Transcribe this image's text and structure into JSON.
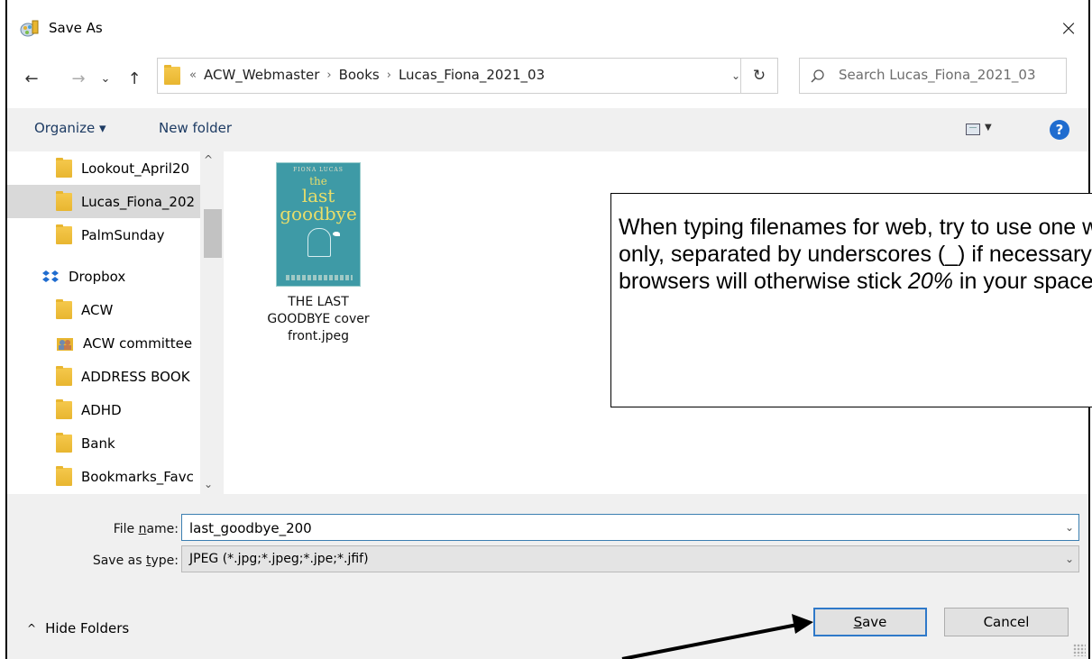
{
  "window": {
    "title": "Save As",
    "close_label": "×"
  },
  "nav": {
    "back": "←",
    "forward": "→",
    "recent": "⌄",
    "up": "↑"
  },
  "address": {
    "prefix": "«",
    "crumbs": [
      "ACW_Webmaster",
      "Books",
      "Lucas_Fiona_2021_03"
    ],
    "separator": "›",
    "refresh": "↻"
  },
  "search": {
    "placeholder": "Search Lucas_Fiona_2021_03"
  },
  "toolbar": {
    "organize_label": "Organize ▾",
    "new_folder_label": "New folder",
    "view_dd": "▼",
    "help": "?"
  },
  "sidebar": {
    "items": [
      {
        "label": "Lookout_April20",
        "icon": "folder-icon",
        "selected": false
      },
      {
        "label": "Lucas_Fiona_202",
        "icon": "folder-icon",
        "selected": true
      },
      {
        "label": "PalmSunday",
        "icon": "folder-icon",
        "selected": false
      },
      {
        "label": "Dropbox",
        "icon": "dropbox-icon",
        "selected": false
      },
      {
        "label": "ACW",
        "icon": "folder-icon",
        "selected": false
      },
      {
        "label": "ACW committee",
        "icon": "shared-folder-icon",
        "selected": false
      },
      {
        "label": "ADDRESS BOOK",
        "icon": "folder-icon",
        "selected": false
      },
      {
        "label": "ADHD",
        "icon": "folder-icon",
        "selected": false
      },
      {
        "label": "Bank",
        "icon": "folder-icon",
        "selected": false
      },
      {
        "label": "Bookmarks_Favc",
        "icon": "folder-icon",
        "selected": false
      }
    ]
  },
  "files": [
    {
      "name_lines": [
        "THE LAST",
        "GOODBYE cover",
        "front.jpeg"
      ],
      "thumb": {
        "author": "FIONA LUCAS",
        "title_small": "the",
        "title_line1": "last",
        "title_line2": "goodbye"
      }
    }
  ],
  "callout": {
    "text_before": "When typing filenames for web, try to use one word only, separated by underscores (_) if necessary.  Web browsers will otherwise stick ",
    "text_italic": "20%",
    "text_after": " in your spaces."
  },
  "form": {
    "file_name_label_pre": "File ",
    "file_name_label_u": "n",
    "file_name_label_post": "ame:",
    "file_name_value": "last_goodbye_200",
    "type_label_pre": "Save as ",
    "type_label_u": "t",
    "type_label_post": "ype:",
    "type_value": "JPEG (*.jpg;*.jpeg;*.jpe;*.jfif)"
  },
  "footer": {
    "hide_folders_label": "Hide Folders",
    "save_label_u": "S",
    "save_label_rest": "ave",
    "cancel_label": "Cancel"
  },
  "colors": {
    "accent": "#2f79c9",
    "folder": "#f0c040",
    "selection": "#d9d9d9",
    "callout_border": "#000000"
  }
}
